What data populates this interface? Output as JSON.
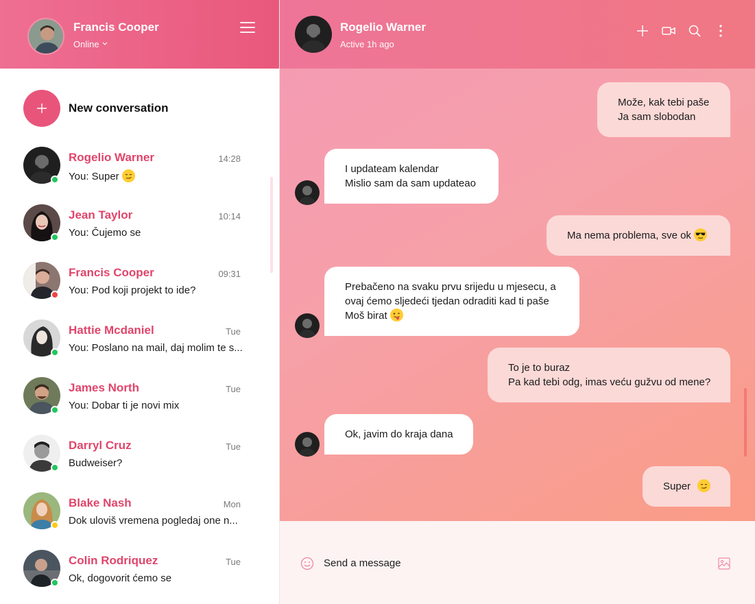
{
  "me": {
    "name": "Francis Cooper",
    "status": "Online"
  },
  "sidebar": {
    "new_conversation_label": "New conversation",
    "conversations": [
      {
        "name": "Rogelio Warner",
        "time": "14:28",
        "preview": "You: Super",
        "preview_emoji": "smirk",
        "status": "online"
      },
      {
        "name": "Jean Taylor",
        "time": "10:14",
        "preview": "You: Čujemo se",
        "status": "online"
      },
      {
        "name": "Francis Cooper",
        "time": "09:31",
        "preview": "You: Pod koji projekt to ide?",
        "status": "busy"
      },
      {
        "name": "Hattie Mcdaniel",
        "time": "Tue",
        "preview": "You: Poslano na mail, daj molim te s...",
        "status": "online"
      },
      {
        "name": "James North",
        "time": "Tue",
        "preview": "You: Dobar ti je novi mix",
        "status": "online"
      },
      {
        "name": "Darryl Cruz",
        "time": "Tue",
        "preview": "Budweiser?",
        "status": "online"
      },
      {
        "name": "Blake Nash",
        "time": "Mon",
        "preview": "Dok uloviš vremena pogledaj one n...",
        "status": "away"
      },
      {
        "name": "Colin Rodriquez",
        "time": "Tue",
        "preview": "Ok, dogovorit ćemo se",
        "status": "online"
      }
    ]
  },
  "chat": {
    "peer_name": "Rogelio Warner",
    "peer_status": "Active 1h ago",
    "messages": [
      {
        "direction": "out",
        "lines": [
          "Može, kak tebi paše",
          "Ja sam slobodan"
        ]
      },
      {
        "direction": "in",
        "lines": [
          "I updateam kalendar",
          "Mislio sam da sam updateao"
        ]
      },
      {
        "direction": "out",
        "lines": [
          "Ma nema problema, sve ok"
        ],
        "emoji": "sunglasses"
      },
      {
        "direction": "in",
        "lines": [
          "Prebačeno na svaku prvu srijedu u mjesecu, a",
          "ovaj ćemo sljedeći tjedan odraditi kad ti paše",
          "Moš birat"
        ],
        "emoji": "wink-tongue"
      },
      {
        "direction": "out",
        "lines": [
          "To je to buraz",
          "Pa kad tebi odg, imas veću gužvu od mene?"
        ]
      },
      {
        "direction": "in",
        "lines": [
          "Ok, javim do kraja dana"
        ]
      },
      {
        "direction": "out",
        "lines": [
          "Super"
        ],
        "emoji": "smirk"
      }
    ]
  },
  "composer": {
    "placeholder": "Send a message"
  },
  "colors": {
    "accent": "#e9557a",
    "online": "#22c55e",
    "busy": "#ef4444",
    "away": "#facc15"
  },
  "icons": [
    "hamburger-icon",
    "plus-icon",
    "video-icon",
    "search-icon",
    "more-vertical-icon",
    "smiley-icon",
    "image-icon"
  ]
}
